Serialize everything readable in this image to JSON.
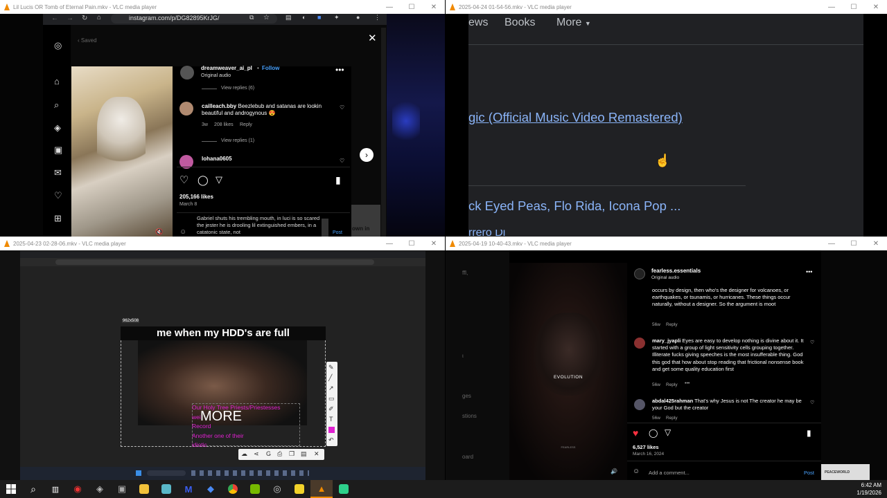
{
  "windows": [
    {
      "title": "Lil Lucis OR Tomb of Eternal Pain.mkv - VLC media player"
    },
    {
      "title": "2025-04-24 01-54-56.mkv - VLC media player"
    },
    {
      "title": "2025-04-23 02-28-06.mkv - VLC media player"
    },
    {
      "title": "2025-04-19 10-40-43.mkv - VLC media player"
    }
  ],
  "w1": {
    "url": "instagram.com/p/DG82895KrJG/",
    "saved": "Saved",
    "username": "dreamweaver_ai_pl",
    "follow": "Follow",
    "audio": "Original audio",
    "view_replies_top": "View replies (6)",
    "comment1_user": "cailleach.bby",
    "comment1_text": "Beezlebub and satanas are lookin beautiful and androgynous 😍",
    "comment1_meta": "3w",
    "comment1_likes": "208 likes",
    "comment1_reply": "Reply",
    "view_replies_mid": "View replies (1)",
    "comment2_user": "lohana0605",
    "likes": "205,166 likes",
    "date": "March 8",
    "caption": "Gabriel shuts his trembling mouth, in luci is so scared the jester he is drooling lil extinguished embers, in a catatonic state, not",
    "post": "Post",
    "right_text": "own in"
  },
  "w2": {
    "nav_news": "ews",
    "nav_books": "Books",
    "nav_more": "More",
    "link1": "gic (Official Music Video Remastered)",
    "link2": "ck Eyed Peas, Flo Rida, Icona Pop ...",
    "link3": "rrero Di"
  },
  "w3": {
    "dim_label": "962x508",
    "meme_top": "me when my HDD's are full",
    "meme_more": "MORE",
    "pink_text_1": "Our Holy Tree Priests/Priestesses",
    "pink_text_2": "wei",
    "pink_text_3": "Record",
    "pink_text_4": "Another one of their",
    "pink_text_5": "idiotic"
  },
  "w4": {
    "username": "fearless.essentials",
    "audio": "Original audio",
    "c0_text": "occurs by design, then who's the designer for volcanoes, or earthquakes, or tsunamis, or hurricanes. These things occur naturally, without a designer. So the argument is moot",
    "c0_meta": "56w",
    "c0_reply": "Reply",
    "c1_user": "mary_jyapli",
    "c1_text": "Eyes are easy to develop nothing is divine about it. It started with a group of light sensitivity cells grouping together. Illiterate fucks giving speeches is the most insufferable thing. God this god that how about stop reading that frictional nonsense book and get some quality education first",
    "c1_meta": "56w",
    "c1_reply": "Reply",
    "c2_user": "abdal425rahman",
    "c2_text": "That's why Jesus is not The creator he may be your God but the creator",
    "c2_meta": "56w",
    "c2_reply": "Reply",
    "likes": "6,527 likes",
    "date": "March 16, 2024",
    "add_comment": "Add a comment...",
    "post": "Post",
    "video_text": "EVOLUTION",
    "video_sub": "FEARLESS",
    "side_1": "ges",
    "side_2": "stions",
    "side_3": "oard",
    "watermark": "PEACEWORLD"
  },
  "taskbar": {
    "time": "6:42 AM",
    "date": "1/19/2026"
  },
  "colors": {
    "link_blue": "#8ab4f8",
    "vlc_orange": "#f08a00",
    "ig_blue": "#4aa3ff",
    "heart_red": "#ff3040",
    "pink": "#e020d0"
  }
}
